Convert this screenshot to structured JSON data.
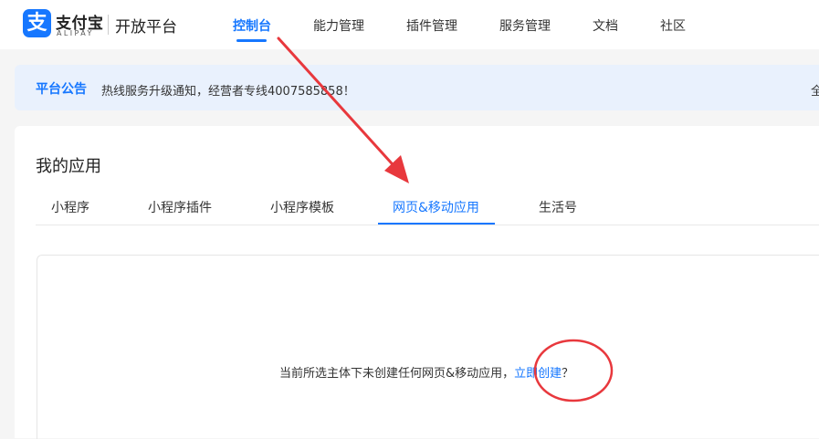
{
  "brand": {
    "logo_glyph": "支",
    "name": "支付宝",
    "sub": "ALIPAY",
    "platform": "开放平台",
    "color": "#1677ff"
  },
  "nav": {
    "items": [
      {
        "label": "控制台",
        "active": true
      },
      {
        "label": "能力管理"
      },
      {
        "label": "插件管理"
      },
      {
        "label": "服务管理"
      },
      {
        "label": "文档"
      },
      {
        "label": "社区"
      }
    ]
  },
  "notice": {
    "title": "平台公告",
    "text": "热线服务升级通知，经营者专线4007585858！",
    "more": "全"
  },
  "apps": {
    "title": "我的应用",
    "tabs": [
      {
        "label": "小程序"
      },
      {
        "label": "小程序插件"
      },
      {
        "label": "小程序模板"
      },
      {
        "label": "网页&移动应用",
        "active": true
      },
      {
        "label": "生活号"
      }
    ],
    "empty_message": "当前所选主体下未创建任何网页&移动应用，",
    "create_link": "立即创建",
    "question_mark": "？"
  },
  "annotation_color": "#e8383d"
}
